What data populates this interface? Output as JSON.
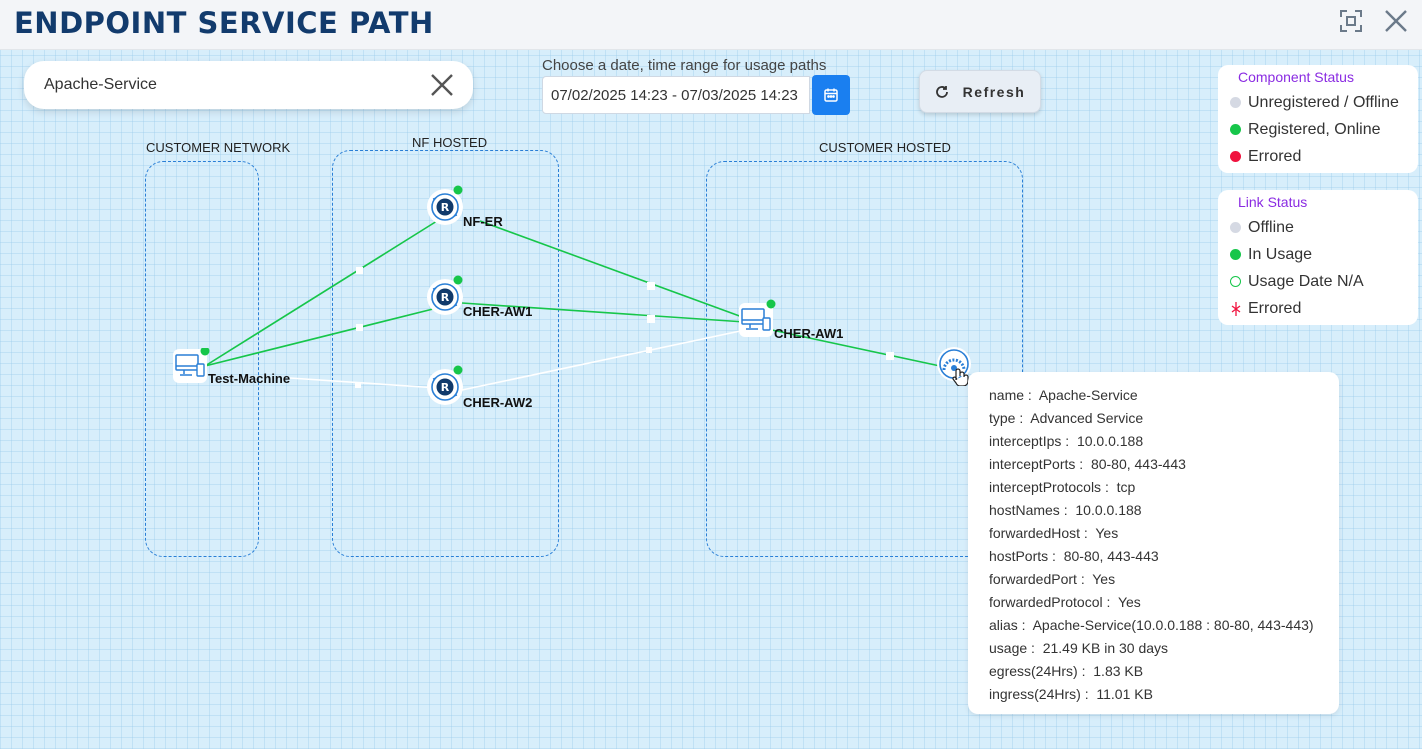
{
  "header": {
    "title": "ENDPOINT SERVICE PATH"
  },
  "search": {
    "value": "Apache-Service"
  },
  "date_range": {
    "label": "Choose a date, time range for usage paths",
    "value": "07/02/2025 14:23 - 07/03/2025 14:23"
  },
  "refresh": {
    "label": "Refresh"
  },
  "component_status": {
    "title": "Component Status",
    "items": [
      {
        "label": "Unregistered / Offline",
        "color": "#d5d9e3"
      },
      {
        "label": "Registered, Online",
        "color": "#16c64a"
      },
      {
        "label": "Errored",
        "color": "#f0123e"
      }
    ]
  },
  "link_status": {
    "title": "Link Status",
    "items": [
      {
        "label": "Offline",
        "color": "#d5d9e3"
      },
      {
        "label": "In Usage",
        "color": "#16c64a"
      },
      {
        "label": "Usage Date N/A",
        "color": "#16c64a"
      },
      {
        "label": "Errored",
        "color": "#f0123e"
      }
    ]
  },
  "zones": {
    "customer_network": "CUSTOMER NETWORK",
    "nf_hosted": "NF HOSTED",
    "customer_hosted": "CUSTOMER HOSTED"
  },
  "nodes": {
    "test_machine": "Test-Machine",
    "nf_er": "NF-ER",
    "cher_aw1_router": "CHER-AW1",
    "cher_aw2": "CHER-AW2",
    "cher_aw1_host": "CHER-AW1"
  },
  "colors": {
    "link_active": "#16c64a",
    "link_offline": "#ffffff",
    "node_online": "#16c64a",
    "accent": "#1a7ff0"
  },
  "tooltip": {
    "rows": [
      {
        "key": "name",
        "value": "Apache-Service"
      },
      {
        "key": "type",
        "value": "Advanced Service"
      },
      {
        "key": "interceptIps",
        "value": "10.0.0.188"
      },
      {
        "key": "interceptPorts",
        "value": " 80-80, 443-443"
      },
      {
        "key": "interceptProtocols",
        "value": "tcp"
      },
      {
        "key": "hostNames",
        "value": "10.0.0.188"
      },
      {
        "key": "forwardedHost",
        "value": "Yes"
      },
      {
        "key": "hostPorts",
        "value": " 80-80, 443-443"
      },
      {
        "key": "forwardedPort",
        "value": "Yes"
      },
      {
        "key": "forwardedProtocol",
        "value": "Yes"
      },
      {
        "key": "alias",
        "value": "Apache-Service(10.0.0.188 :  80-80, 443-443)"
      },
      {
        "key": "usage",
        "value": "21.49 KB in 30 days"
      },
      {
        "key": "egress(24Hrs)",
        "value": "1.83 KB"
      },
      {
        "key": "ingress(24Hrs)",
        "value": "11.01 KB"
      }
    ]
  }
}
